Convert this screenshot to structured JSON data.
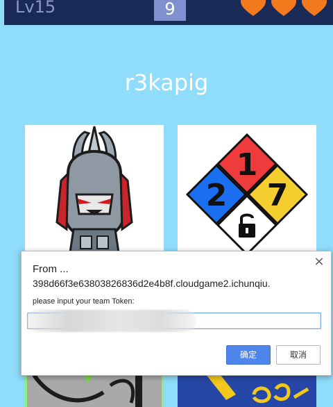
{
  "header": {
    "level": "Lv15",
    "counter": "9",
    "hearts": 3,
    "heart_color": "#f57a1e"
  },
  "player": {
    "name": "r3kapig"
  },
  "dialog": {
    "title": "From ...",
    "host": "398d66f3e63803826836d2e4b8f.cloudgame2.ichunqiu.",
    "prompt": "please input your team Token:",
    "input_value": "",
    "ok_label": "确定",
    "cancel_label": "取消",
    "close_symbol": "×"
  },
  "cards": [
    {
      "name": "winged-warrior-mascot"
    },
    {
      "name": "hazard-diamond",
      "numbers": [
        "1",
        "2",
        "7"
      ]
    },
    {
      "name": "partial-card-grey"
    },
    {
      "name": "partial-card-blue"
    }
  ],
  "colors": {
    "background": "#8fdcfb",
    "topbar": "#1a2a57",
    "accent_button": "#4f86ec"
  }
}
